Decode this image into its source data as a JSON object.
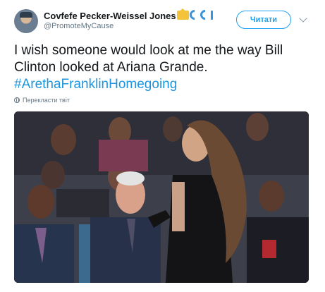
{
  "tweet": {
    "author": {
      "display_name": "Covfefe Pecker-Weissel Jones",
      "handle": "@PromoteMyCause",
      "badge_icons": [
        "crown-emoji",
        "wave-emoji",
        "wave-emoji",
        "bar-emoji"
      ]
    },
    "follow_label": "Читати",
    "more_icon": "chevron-down-icon",
    "text_line1": "I wish someone would look at me the way Bill",
    "text_line2": "Clinton looked at Ariana Grande.",
    "hashtag": "#ArethaFranklinHomegoing",
    "translate_label": "Перекласти твіт",
    "media_kind": "photo",
    "colors": {
      "accent": "#1da1f2",
      "hashtag": "#1b95e0",
      "text": "#14171a",
      "secondary": "#657786"
    }
  }
}
